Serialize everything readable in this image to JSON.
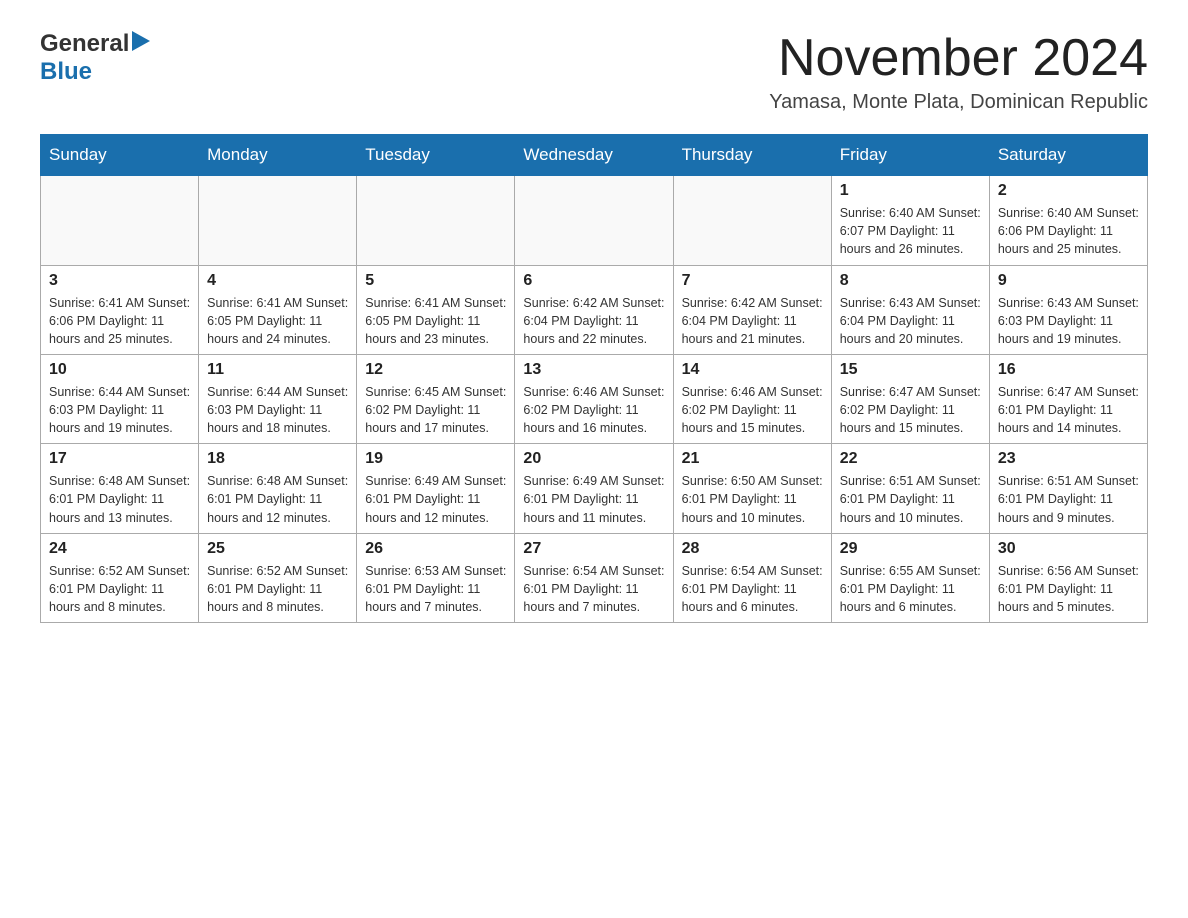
{
  "header": {
    "logo_general": "General",
    "logo_blue": "Blue",
    "month_title": "November 2024",
    "location": "Yamasa, Monte Plata, Dominican Republic"
  },
  "days_of_week": [
    "Sunday",
    "Monday",
    "Tuesday",
    "Wednesday",
    "Thursday",
    "Friday",
    "Saturday"
  ],
  "weeks": [
    [
      {
        "day": "",
        "info": ""
      },
      {
        "day": "",
        "info": ""
      },
      {
        "day": "",
        "info": ""
      },
      {
        "day": "",
        "info": ""
      },
      {
        "day": "",
        "info": ""
      },
      {
        "day": "1",
        "info": "Sunrise: 6:40 AM\nSunset: 6:07 PM\nDaylight: 11 hours and 26 minutes."
      },
      {
        "day": "2",
        "info": "Sunrise: 6:40 AM\nSunset: 6:06 PM\nDaylight: 11 hours and 25 minutes."
      }
    ],
    [
      {
        "day": "3",
        "info": "Sunrise: 6:41 AM\nSunset: 6:06 PM\nDaylight: 11 hours and 25 minutes."
      },
      {
        "day": "4",
        "info": "Sunrise: 6:41 AM\nSunset: 6:05 PM\nDaylight: 11 hours and 24 minutes."
      },
      {
        "day": "5",
        "info": "Sunrise: 6:41 AM\nSunset: 6:05 PM\nDaylight: 11 hours and 23 minutes."
      },
      {
        "day": "6",
        "info": "Sunrise: 6:42 AM\nSunset: 6:04 PM\nDaylight: 11 hours and 22 minutes."
      },
      {
        "day": "7",
        "info": "Sunrise: 6:42 AM\nSunset: 6:04 PM\nDaylight: 11 hours and 21 minutes."
      },
      {
        "day": "8",
        "info": "Sunrise: 6:43 AM\nSunset: 6:04 PM\nDaylight: 11 hours and 20 minutes."
      },
      {
        "day": "9",
        "info": "Sunrise: 6:43 AM\nSunset: 6:03 PM\nDaylight: 11 hours and 19 minutes."
      }
    ],
    [
      {
        "day": "10",
        "info": "Sunrise: 6:44 AM\nSunset: 6:03 PM\nDaylight: 11 hours and 19 minutes."
      },
      {
        "day": "11",
        "info": "Sunrise: 6:44 AM\nSunset: 6:03 PM\nDaylight: 11 hours and 18 minutes."
      },
      {
        "day": "12",
        "info": "Sunrise: 6:45 AM\nSunset: 6:02 PM\nDaylight: 11 hours and 17 minutes."
      },
      {
        "day": "13",
        "info": "Sunrise: 6:46 AM\nSunset: 6:02 PM\nDaylight: 11 hours and 16 minutes."
      },
      {
        "day": "14",
        "info": "Sunrise: 6:46 AM\nSunset: 6:02 PM\nDaylight: 11 hours and 15 minutes."
      },
      {
        "day": "15",
        "info": "Sunrise: 6:47 AM\nSunset: 6:02 PM\nDaylight: 11 hours and 15 minutes."
      },
      {
        "day": "16",
        "info": "Sunrise: 6:47 AM\nSunset: 6:01 PM\nDaylight: 11 hours and 14 minutes."
      }
    ],
    [
      {
        "day": "17",
        "info": "Sunrise: 6:48 AM\nSunset: 6:01 PM\nDaylight: 11 hours and 13 minutes."
      },
      {
        "day": "18",
        "info": "Sunrise: 6:48 AM\nSunset: 6:01 PM\nDaylight: 11 hours and 12 minutes."
      },
      {
        "day": "19",
        "info": "Sunrise: 6:49 AM\nSunset: 6:01 PM\nDaylight: 11 hours and 12 minutes."
      },
      {
        "day": "20",
        "info": "Sunrise: 6:49 AM\nSunset: 6:01 PM\nDaylight: 11 hours and 11 minutes."
      },
      {
        "day": "21",
        "info": "Sunrise: 6:50 AM\nSunset: 6:01 PM\nDaylight: 11 hours and 10 minutes."
      },
      {
        "day": "22",
        "info": "Sunrise: 6:51 AM\nSunset: 6:01 PM\nDaylight: 11 hours and 10 minutes."
      },
      {
        "day": "23",
        "info": "Sunrise: 6:51 AM\nSunset: 6:01 PM\nDaylight: 11 hours and 9 minutes."
      }
    ],
    [
      {
        "day": "24",
        "info": "Sunrise: 6:52 AM\nSunset: 6:01 PM\nDaylight: 11 hours and 8 minutes."
      },
      {
        "day": "25",
        "info": "Sunrise: 6:52 AM\nSunset: 6:01 PM\nDaylight: 11 hours and 8 minutes."
      },
      {
        "day": "26",
        "info": "Sunrise: 6:53 AM\nSunset: 6:01 PM\nDaylight: 11 hours and 7 minutes."
      },
      {
        "day": "27",
        "info": "Sunrise: 6:54 AM\nSunset: 6:01 PM\nDaylight: 11 hours and 7 minutes."
      },
      {
        "day": "28",
        "info": "Sunrise: 6:54 AM\nSunset: 6:01 PM\nDaylight: 11 hours and 6 minutes."
      },
      {
        "day": "29",
        "info": "Sunrise: 6:55 AM\nSunset: 6:01 PM\nDaylight: 11 hours and 6 minutes."
      },
      {
        "day": "30",
        "info": "Sunrise: 6:56 AM\nSunset: 6:01 PM\nDaylight: 11 hours and 5 minutes."
      }
    ]
  ]
}
